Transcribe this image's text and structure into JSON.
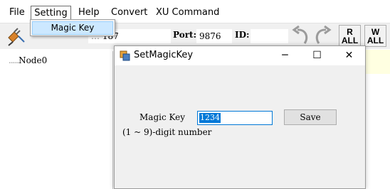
{
  "menubar": {
    "items": [
      "File",
      "Setting",
      "Help",
      "Convert",
      "XU Command"
    ]
  },
  "dropdown": {
    "items": [
      "Magic Key"
    ]
  },
  "toolbar": {
    "host_value_partial": "187",
    "port_label": "Port:",
    "port_value": "9876",
    "id_label": "ID:",
    "id_value": "",
    "read_all_label": [
      "R",
      "ALL"
    ],
    "write_all_label": [
      "W",
      "ALL"
    ]
  },
  "tree": {
    "root_label": "Node0"
  },
  "dialog": {
    "title": "SetMagicKey",
    "minimize": "─",
    "maximize": "☐",
    "close": "✕",
    "magic_key_label": "Magic Key",
    "hint_label": "(1 ~ 9)-digit number",
    "magic_key_value": "1234",
    "save_label": "Save"
  },
  "colors": {
    "selection": "#0078d7",
    "menu_highlight": "#cce8ff",
    "dialog_body": "#f0f0f0"
  }
}
